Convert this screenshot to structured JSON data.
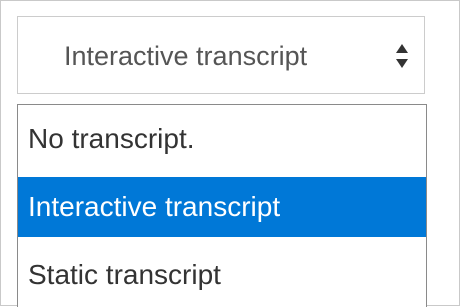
{
  "select": {
    "current_value": "Interactive transcript"
  },
  "options": [
    {
      "label": "No transcript.",
      "selected": false
    },
    {
      "label": "Interactive transcript",
      "selected": true
    },
    {
      "label": "Static transcript",
      "selected": false
    }
  ],
  "colors": {
    "highlight": "#0078d7",
    "highlight_text": "#ffffff",
    "option_text": "#333333",
    "select_text": "#555555"
  },
  "icons": {
    "select_arrow": "sort-updown-icon"
  }
}
